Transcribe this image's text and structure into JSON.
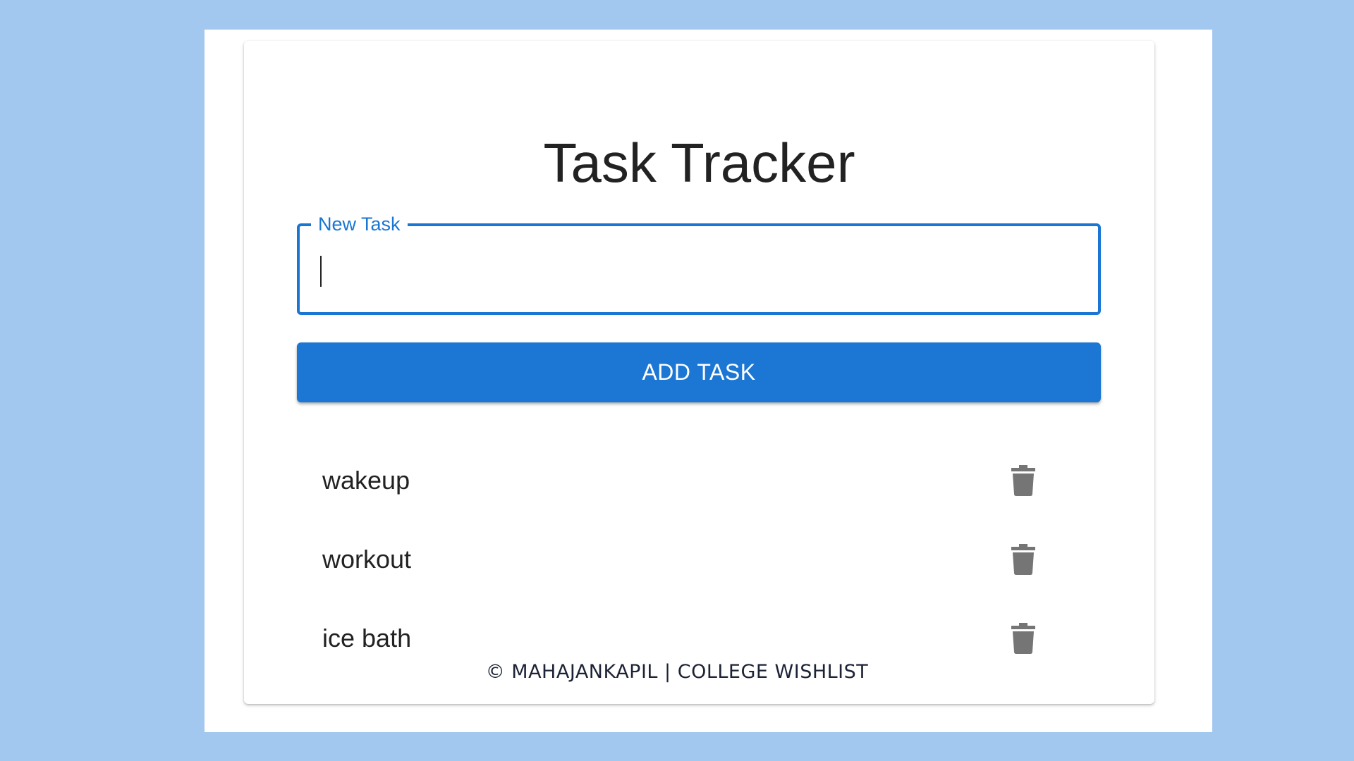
{
  "app": {
    "title": "Task Tracker"
  },
  "new_task": {
    "label": "New Task",
    "value": "",
    "placeholder": ""
  },
  "add_button": {
    "label": "ADD TASK"
  },
  "tasks": [
    {
      "text": "wakeup",
      "delete_icon": "trash-icon"
    },
    {
      "text": "workout",
      "delete_icon": "trash-icon"
    },
    {
      "text": "ice bath",
      "delete_icon": "trash-icon"
    }
  ],
  "footer": {
    "text": "© MAHAJANKAPIL | COLLEGE WISHLIST"
  },
  "colors": {
    "page_background": "#a3c8f0",
    "accent": "#1976d2",
    "button": "#1b76d4",
    "icon": "#757575",
    "text": "#222222"
  }
}
